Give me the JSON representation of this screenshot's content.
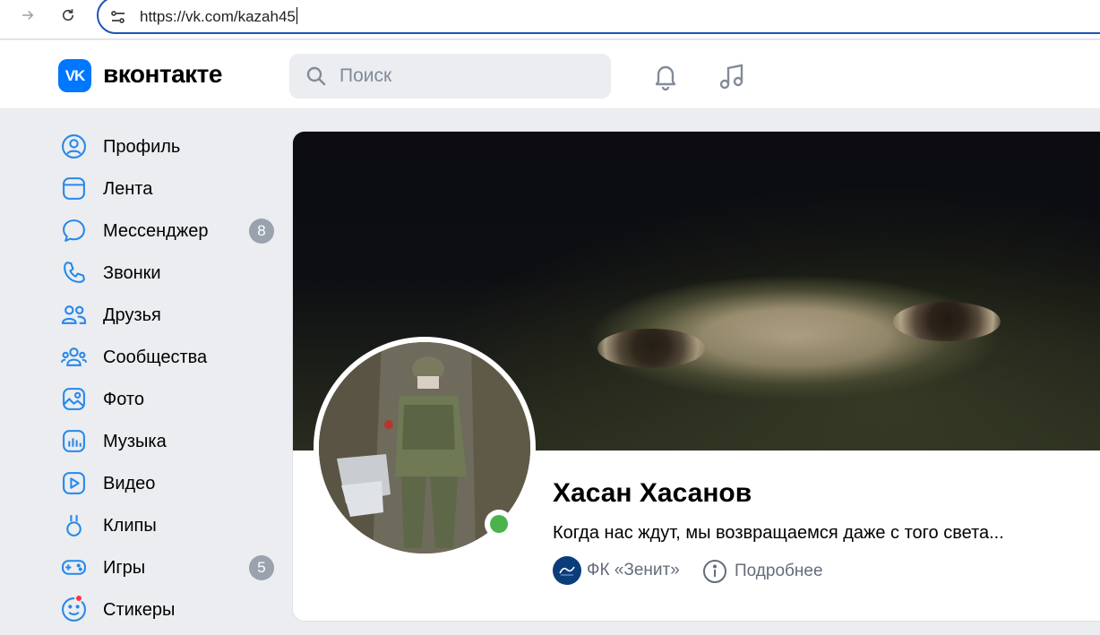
{
  "browser": {
    "url": "https://vk.com/kazah45",
    "icons": {
      "forward": "forward-arrow-icon",
      "reload": "reload-icon",
      "site_info": "site-settings-icon"
    }
  },
  "header": {
    "logo_mark": "VK",
    "wordmark": "вконтакте",
    "search": {
      "placeholder": "Поиск",
      "value": ""
    },
    "icons": [
      "bell-icon",
      "music-icon"
    ],
    "accent_color": "#0077ff"
  },
  "sidebar": {
    "items": [
      {
        "label": "Профиль",
        "icon": "profile-icon"
      },
      {
        "label": "Лента",
        "icon": "feed-icon"
      },
      {
        "label": "Мессенджер",
        "icon": "messenger-icon",
        "badge": "8"
      },
      {
        "label": "Звонки",
        "icon": "phone-icon"
      },
      {
        "label": "Друзья",
        "icon": "friends-icon"
      },
      {
        "label": "Сообщества",
        "icon": "communities-icon"
      },
      {
        "label": "Фото",
        "icon": "photo-icon"
      },
      {
        "label": "Музыка",
        "icon": "music-icon"
      },
      {
        "label": "Видео",
        "icon": "video-icon"
      },
      {
        "label": "Клипы",
        "icon": "clips-icon"
      },
      {
        "label": "Игры",
        "icon": "games-icon",
        "badge": "5"
      },
      {
        "label": "Стикеры",
        "icon": "stickers-icon",
        "notification_dot": true
      }
    ]
  },
  "profile": {
    "name": "Хасан Хасанов",
    "status": "Когда нас ждут, мы возвращаемся даже с того света...",
    "online": true,
    "club": "ФК «Зенит»",
    "more_label": "Подробнее"
  }
}
